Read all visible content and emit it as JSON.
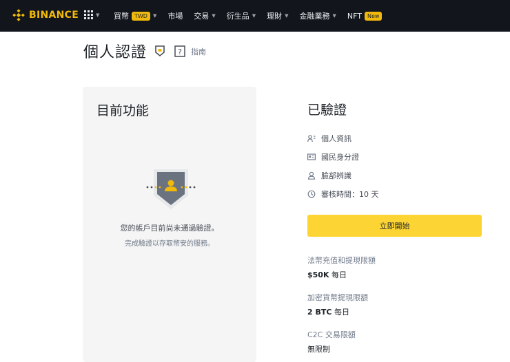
{
  "nav": {
    "brand": "BINANCE",
    "items": [
      {
        "label": "買幣",
        "badge": "TWD",
        "dropdown": true
      },
      {
        "label": "市場",
        "badge": "",
        "dropdown": false
      },
      {
        "label": "交易",
        "badge": "",
        "dropdown": true
      },
      {
        "label": "衍生品",
        "badge": "",
        "dropdown": true
      },
      {
        "label": "理財",
        "badge": "",
        "dropdown": true
      },
      {
        "label": "金融業務",
        "badge": "",
        "dropdown": true
      },
      {
        "label": "NFT",
        "badge": "New",
        "dropdown": false
      }
    ]
  },
  "page": {
    "title": "個人認證",
    "guide": "指南"
  },
  "current_features": {
    "heading": "目前功能",
    "message": "您的帳戶目前尚未通過驗證。",
    "hint": "完成驗證以存取幣安的服務。"
  },
  "verified": {
    "heading": "已驗證",
    "items": [
      {
        "icon": "id-card-icon",
        "label": "個人資訊"
      },
      {
        "icon": "national-id-icon",
        "label": "國民身分證"
      },
      {
        "icon": "face-icon",
        "label": "臉部辨識"
      },
      {
        "icon": "clock-icon",
        "label": "審核時間：10 天"
      }
    ],
    "start_button": "立即開始"
  },
  "limits": [
    {
      "label": "法幣充值和提現限額",
      "value": "$50K",
      "suffix": "每日"
    },
    {
      "label": "加密貨幣提現限額",
      "value": "2 BTC",
      "suffix": "每日"
    },
    {
      "label": "C2C 交易限額",
      "value": "無限制",
      "suffix": ""
    }
  ],
  "colors": {
    "brand": "#f0b90b",
    "nav_bg": "#12161c",
    "button": "#fcd535",
    "card_bg": "#f5f5f5",
    "shield": "#6b7280"
  }
}
